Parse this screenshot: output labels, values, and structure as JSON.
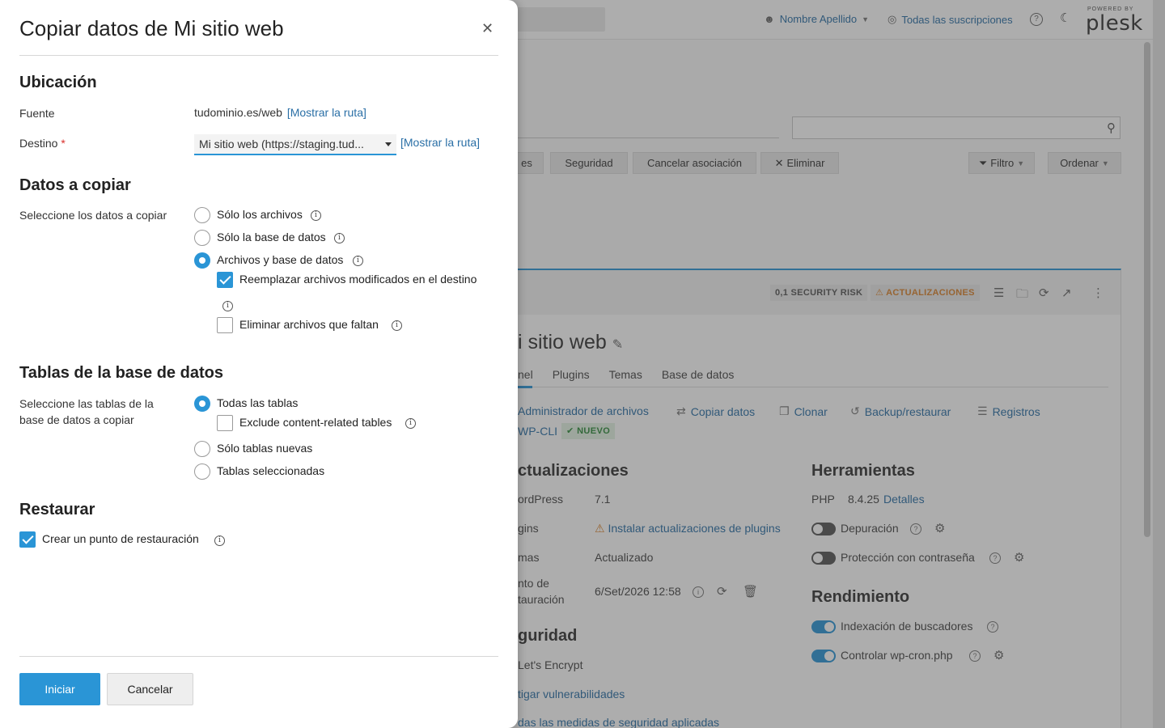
{
  "background": {
    "header": {
      "user_name": "Nombre Apellido",
      "subscriptions": "Todas las suscripciones",
      "powered_by": "POWERED BY",
      "brand": "plesk"
    },
    "toolbar": {
      "partial_button": "es",
      "security_button": "Seguridad",
      "cancel_assoc_button": "Cancelar asociación",
      "delete_button": "Eliminar",
      "filter_button": "Filtro",
      "sort_button": "Ordenar"
    },
    "card": {
      "security_risk_badge": "0,1 SECURITY RISK",
      "updates_badge": "ACTUALIZACIONES",
      "site_title": "i sitio web",
      "tabs": [
        "nel",
        "Plugins",
        "Temas",
        "Base de datos"
      ],
      "actions": {
        "file_manager": "Administrador de archivos",
        "copy_data": "Copiar datos",
        "clone": "Clonar",
        "backup": "Backup/restaurar",
        "logs": "Registros",
        "wpcli": "WP-CLI",
        "new_badge": "NUEVO"
      },
      "updates_section": {
        "heading": "ctualizaciones",
        "wordpress_label": "ordPress",
        "wordpress_value": "7.1",
        "plugins_label": "gins",
        "plugins_value": "Instalar actualizaciones de plugins",
        "themes_label": "mas",
        "themes_value": "Actualizado",
        "restore_label_1": "nto de",
        "restore_label_2": "tauración",
        "restore_value": "6/Set/2026 12:58"
      },
      "security_section": {
        "heading": "guridad",
        "letsencrypt": "Let's Encrypt",
        "vulnerabilities": "tigar vulnerabilidades",
        "all_measures": "das las medidas de seguridad aplicadas"
      },
      "tools_section": {
        "heading": "Herramientas",
        "php_label": "PHP",
        "php_version": "8.4.25",
        "php_details": "Detalles",
        "debug": "Depuración",
        "password_protection": "Protección con contraseña"
      },
      "performance_section": {
        "heading": "Rendimiento",
        "search_indexing": "Indexación de buscadores",
        "wp_cron": "Controlar wp-cron.php"
      }
    }
  },
  "modal": {
    "title": "Copiar datos de Mi sitio web",
    "location": {
      "heading": "Ubicación",
      "source_label": "Fuente",
      "source_value": "tudominio.es/web",
      "show_path": "[Mostrar la ruta]",
      "destination_label": "Destino",
      "required_mark": "*",
      "destination_value": "Mi sitio web (https://staging.tud...",
      "destination_show_path": "[Mostrar la ruta]"
    },
    "data_to_copy": {
      "heading": "Datos a copiar",
      "label": "Seleccione los datos a copiar",
      "option_files": "Sólo los archivos",
      "option_db": "Sólo la base de datos",
      "option_both": "Archivos y base de datos",
      "replace_modified": "Reemplazar archivos modificados en el destino",
      "delete_missing": "Eliminar archivos que faltan"
    },
    "db_tables": {
      "heading": "Tablas de la base de datos",
      "label": "Seleccione las tablas de la base de datos a copiar",
      "option_all": "Todas las tablas",
      "exclude_content": "Exclude content-related tables",
      "option_new": "Sólo tablas nuevas",
      "option_selected": "Tablas seleccionadas"
    },
    "restore": {
      "heading": "Restaurar",
      "create_point": "Crear un punto de restauración"
    },
    "buttons": {
      "start": "Iniciar",
      "cancel": "Cancelar"
    }
  },
  "colors": {
    "accent": "#2a95d6",
    "link": "#2a6fa6",
    "warning": "#d9822b",
    "required": "#d9302c"
  }
}
